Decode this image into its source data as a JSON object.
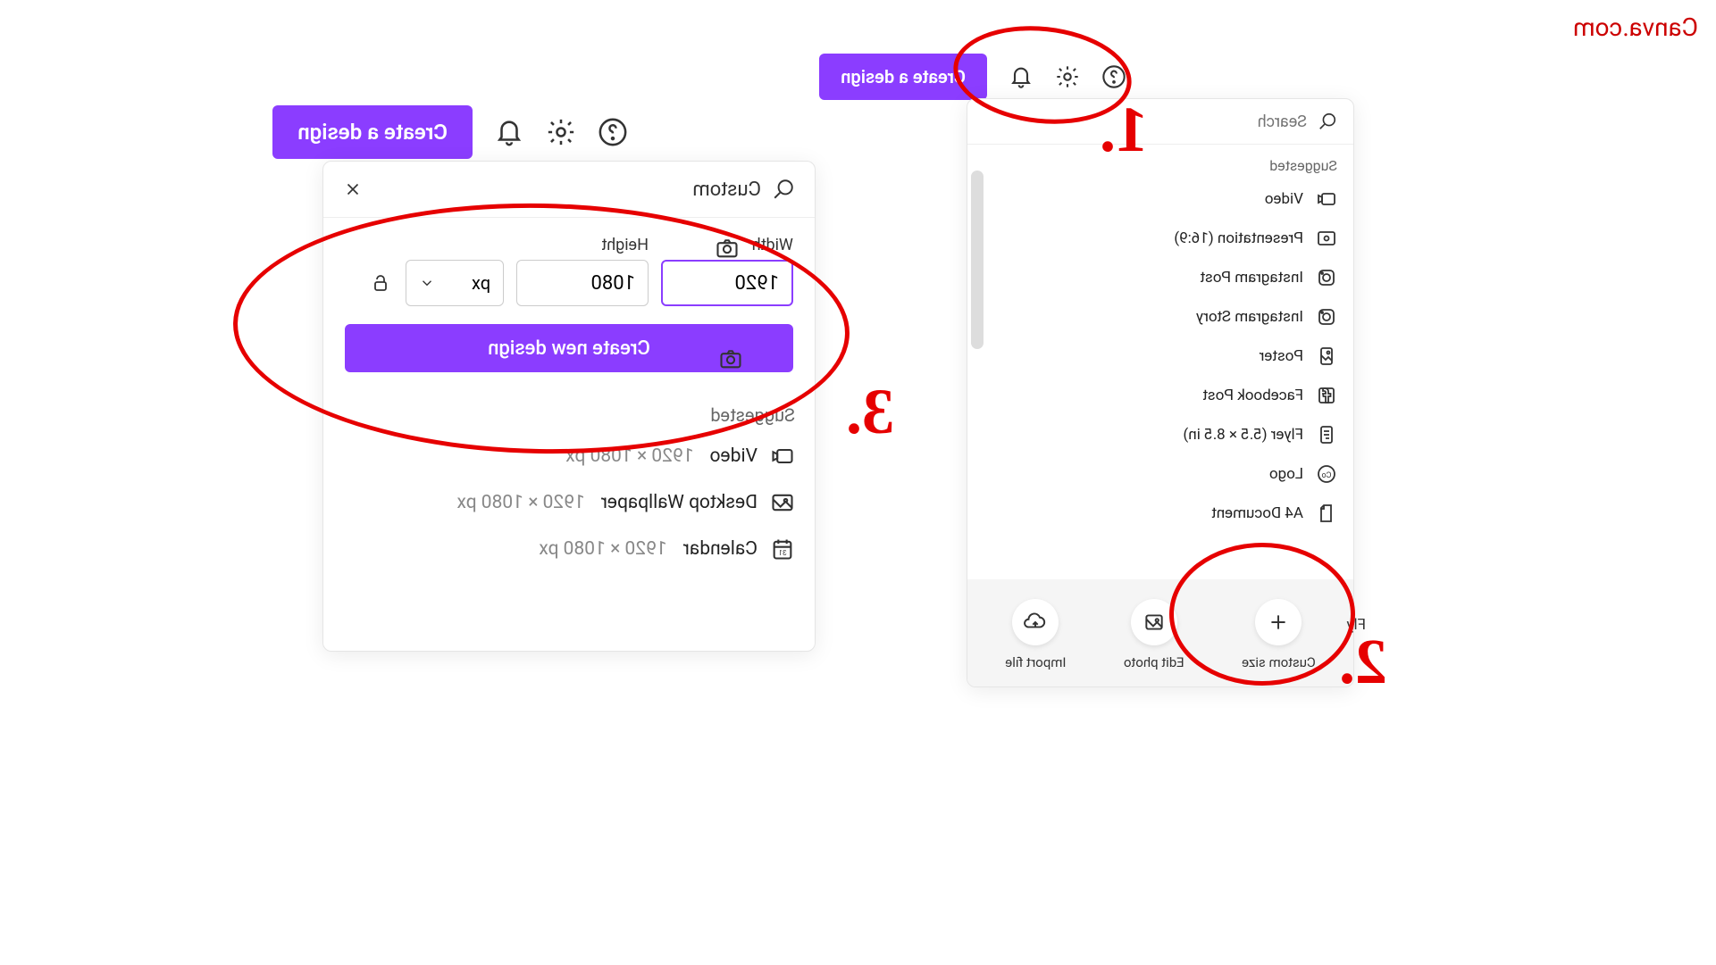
{
  "watermark": "Canva.com",
  "header": {
    "create_label": "Create a design"
  },
  "panel1": {
    "search_placeholder": "Search",
    "suggested_label": "Suggested",
    "items": [
      {
        "label": "Video"
      },
      {
        "label": "Presentation (16:9)"
      },
      {
        "label": "Instagram Post"
      },
      {
        "label": "Instagram Story"
      },
      {
        "label": "Poster"
      },
      {
        "label": "Facebook Post"
      },
      {
        "label": "Flyer (5.5 × 8.5 in)"
      },
      {
        "label": "Logo"
      },
      {
        "label": "A4 Document"
      }
    ],
    "bottom": {
      "custom": "Custom size",
      "edit": "Edit photo",
      "import": "Import file"
    }
  },
  "panel2": {
    "search_value": "Custom",
    "width_label": "Width",
    "height_label": "Height",
    "width_value": "1920",
    "height_value": "1080",
    "unit": "px",
    "create_label": "Create new design",
    "suggested_label": "Suggested",
    "items": [
      {
        "label": "Video",
        "dim": "1920 × 1080 px"
      },
      {
        "label": "Desktop Wallpaper",
        "dim": "1920 × 1080 px"
      },
      {
        "label": "Calendar",
        "dim": "1920 × 1080 px"
      }
    ]
  },
  "callouts": {
    "n1": "1.",
    "n2": "2.",
    "n3": "3."
  },
  "partial": {
    "fly": "Fly",
    "siz": "siz"
  }
}
